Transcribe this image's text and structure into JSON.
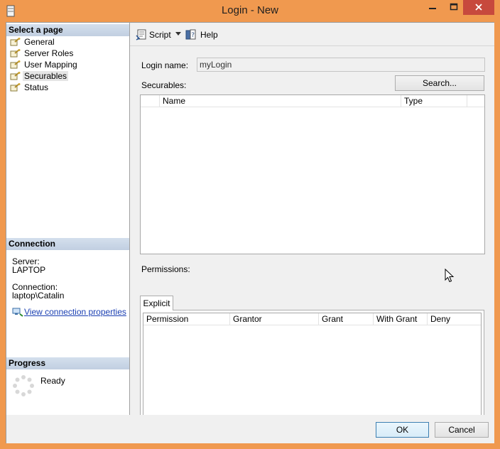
{
  "window": {
    "title": "Login - New"
  },
  "sidebar": {
    "select_page_header": "Select a page",
    "items": [
      {
        "label": "General",
        "icon": "page-wrench-icon"
      },
      {
        "label": "Server Roles",
        "icon": "page-wrench-icon"
      },
      {
        "label": "User Mapping",
        "icon": "page-wrench-icon"
      },
      {
        "label": "Securables",
        "icon": "page-wrench-icon",
        "selected": true
      },
      {
        "label": "Status",
        "icon": "page-wrench-icon"
      }
    ],
    "connection_header": "Connection",
    "server_label": "Server:",
    "server_value": "LAPTOP",
    "connection_label": "Connection:",
    "connection_value": "laptop\\Catalin",
    "view_connection_link": "View connection properties",
    "progress_header": "Progress",
    "progress_status": "Ready"
  },
  "toolbar": {
    "script_label": "Script",
    "help_label": "Help"
  },
  "form": {
    "login_name_label": "Login name:",
    "login_name_value": "myLogin",
    "securables_label": "Securables:",
    "search_button": "Search...",
    "securables_columns": [
      "",
      "Name",
      "Type",
      ""
    ],
    "permissions_label": "Permissions:",
    "permissions_tab": "Explicit",
    "permissions_columns": [
      "Permission",
      "Grantor",
      "Grant",
      "With Grant",
      "Deny"
    ]
  },
  "footer": {
    "ok_label": "OK",
    "cancel_label": "Cancel"
  },
  "colors": {
    "window_frame": "#f0994f",
    "close_button": "#c7493d",
    "section_header": "#c9d6e8",
    "link": "#1a3fb2"
  }
}
